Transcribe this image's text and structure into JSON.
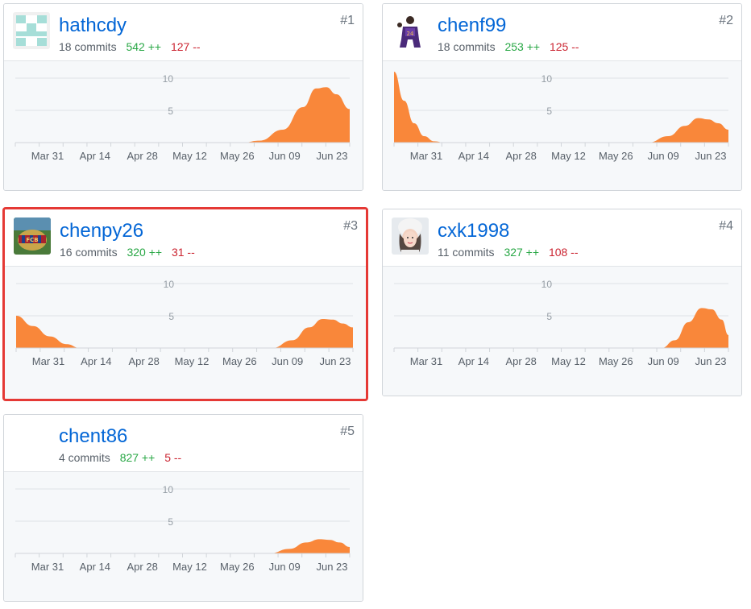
{
  "contributors": [
    {
      "rank": "#1",
      "username": "hathcdy",
      "commits": "18 commits",
      "additions": "542 ++",
      "deletions": "127 --",
      "avatar": "identicon-icon",
      "highlighted": false,
      "chart_data": {
        "type": "area",
        "x": [
          "Mar 31",
          "Apr 14",
          "Apr 28",
          "May 12",
          "May 26",
          "Jun 09",
          "Jun 23"
        ],
        "y_ticks": [
          "5",
          "10"
        ],
        "ylim": [
          0,
          10
        ],
        "color": "#f9873a",
        "points": [
          [
            0,
            0
          ],
          [
            0.68,
            0
          ],
          [
            0.73,
            0.3
          ],
          [
            0.8,
            2.0
          ],
          [
            0.86,
            5.5
          ],
          [
            0.9,
            8.4
          ],
          [
            0.93,
            8.6
          ],
          [
            0.96,
            7.5
          ],
          [
            1.0,
            5.2
          ]
        ]
      }
    },
    {
      "rank": "#2",
      "username": "chenf99",
      "commits": "18 commits",
      "additions": "253 ++",
      "deletions": "125 --",
      "avatar": "basketball-player-avatar-icon",
      "highlighted": false,
      "chart_data": {
        "type": "area",
        "x": [
          "Mar 31",
          "Apr 14",
          "Apr 28",
          "May 12",
          "May 26",
          "Jun 09",
          "Jun 23"
        ],
        "y_ticks": [
          "5",
          "10"
        ],
        "ylim": [
          0,
          10
        ],
        "color": "#f9873a",
        "points": [
          [
            0,
            11
          ],
          [
            0.03,
            6.5
          ],
          [
            0.06,
            3
          ],
          [
            0.09,
            1
          ],
          [
            0.12,
            0.2
          ],
          [
            0.15,
            0
          ],
          [
            0.76,
            0
          ],
          [
            0.82,
            1.0
          ],
          [
            0.87,
            2.6
          ],
          [
            0.91,
            3.8
          ],
          [
            0.94,
            3.6
          ],
          [
            0.97,
            3.0
          ],
          [
            1.0,
            2.0
          ]
        ]
      }
    },
    {
      "rank": "#3",
      "username": "chenpy26",
      "commits": "16 commits",
      "additions": "320 ++",
      "deletions": "31 --",
      "avatar": "fcb-logo-avatar-icon",
      "highlighted": true,
      "chart_data": {
        "type": "area",
        "x": [
          "Mar 31",
          "Apr 14",
          "Apr 28",
          "May 12",
          "May 26",
          "Jun 09",
          "Jun 23"
        ],
        "y_ticks": [
          "5",
          "10"
        ],
        "ylim": [
          0,
          10
        ],
        "color": "#f9873a",
        "points": [
          [
            0,
            5
          ],
          [
            0.05,
            3.4
          ],
          [
            0.1,
            1.8
          ],
          [
            0.15,
            0.6
          ],
          [
            0.19,
            0
          ],
          [
            0.76,
            0
          ],
          [
            0.82,
            1.2
          ],
          [
            0.87,
            3.2
          ],
          [
            0.91,
            4.5
          ],
          [
            0.94,
            4.4
          ],
          [
            0.97,
            3.8
          ],
          [
            1.0,
            3.2
          ]
        ]
      }
    },
    {
      "rank": "#4",
      "username": "cxk1998",
      "commits": "11 commits",
      "additions": "327 ++",
      "deletions": "108 --",
      "avatar": "user-photo-avatar-icon",
      "highlighted": false,
      "chart_data": {
        "type": "area",
        "x": [
          "Mar 31",
          "Apr 14",
          "Apr 28",
          "May 12",
          "May 26",
          "Jun 09",
          "Jun 23"
        ],
        "y_ticks": [
          "5",
          "10"
        ],
        "ylim": [
          0,
          10
        ],
        "color": "#f9873a",
        "points": [
          [
            0,
            0
          ],
          [
            0.8,
            0
          ],
          [
            0.84,
            1.2
          ],
          [
            0.88,
            4.0
          ],
          [
            0.92,
            6.2
          ],
          [
            0.95,
            6.0
          ],
          [
            0.98,
            4.4
          ],
          [
            1.0,
            2.0
          ]
        ]
      }
    },
    {
      "rank": "#5",
      "username": "chent86",
      "commits": "4 commits",
      "additions": "827 ++",
      "deletions": "5 --",
      "avatar": "blank-avatar-icon",
      "highlighted": false,
      "chart_data": {
        "type": "area",
        "x": [
          "Mar 31",
          "Apr 14",
          "Apr 28",
          "May 12",
          "May 26",
          "Jun 09",
          "Jun 23"
        ],
        "y_ticks": [
          "5",
          "10"
        ],
        "ylim": [
          0,
          10
        ],
        "color": "#f9873a",
        "points": [
          [
            0,
            0
          ],
          [
            0.76,
            0
          ],
          [
            0.82,
            0.7
          ],
          [
            0.87,
            1.7
          ],
          [
            0.91,
            2.2
          ],
          [
            0.94,
            2.1
          ],
          [
            0.97,
            1.7
          ],
          [
            1.0,
            1.0
          ]
        ]
      }
    }
  ]
}
